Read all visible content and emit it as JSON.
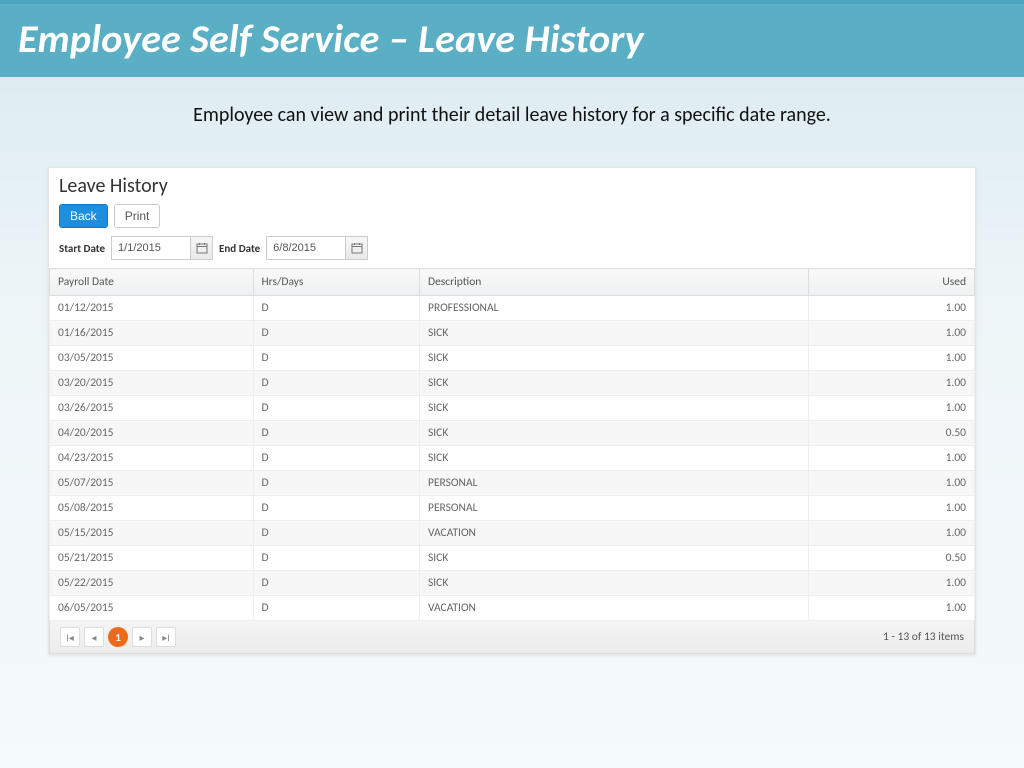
{
  "header": {
    "title": "Employee Self Service – Leave History"
  },
  "subtitle": "Employee can view and print their detail leave history for a specific date range.",
  "panel": {
    "title": "Leave History",
    "buttons": {
      "back": "Back",
      "print": "Print"
    },
    "dates": {
      "start_label": "Start Date",
      "start_value": "1/1/2015",
      "end_label": "End Date",
      "end_value": "6/8/2015"
    },
    "columns": [
      "Payroll Date",
      "Hrs/Days",
      "Description",
      "Used"
    ],
    "rows": [
      {
        "date": "01/12/2015",
        "hd": "D",
        "desc": "PROFESSIONAL",
        "used": "1.00"
      },
      {
        "date": "01/16/2015",
        "hd": "D",
        "desc": "SICK",
        "used": "1.00"
      },
      {
        "date": "03/05/2015",
        "hd": "D",
        "desc": "SICK",
        "used": "1.00"
      },
      {
        "date": "03/20/2015",
        "hd": "D",
        "desc": "SICK",
        "used": "1.00"
      },
      {
        "date": "03/26/2015",
        "hd": "D",
        "desc": "SICK",
        "used": "1.00"
      },
      {
        "date": "04/20/2015",
        "hd": "D",
        "desc": "SICK",
        "used": "0.50"
      },
      {
        "date": "04/23/2015",
        "hd": "D",
        "desc": "SICK",
        "used": "1.00"
      },
      {
        "date": "05/07/2015",
        "hd": "D",
        "desc": "PERSONAL",
        "used": "1.00"
      },
      {
        "date": "05/08/2015",
        "hd": "D",
        "desc": "PERSONAL",
        "used": "1.00"
      },
      {
        "date": "05/15/2015",
        "hd": "D",
        "desc": "VACATION",
        "used": "1.00"
      },
      {
        "date": "05/21/2015",
        "hd": "D",
        "desc": "SICK",
        "used": "0.50"
      },
      {
        "date": "05/22/2015",
        "hd": "D",
        "desc": "SICK",
        "used": "1.00"
      },
      {
        "date": "06/05/2015",
        "hd": "D",
        "desc": "VACATION",
        "used": "1.00"
      }
    ],
    "pager": {
      "current": "1",
      "info": "1 - 13 of 13 items"
    }
  }
}
